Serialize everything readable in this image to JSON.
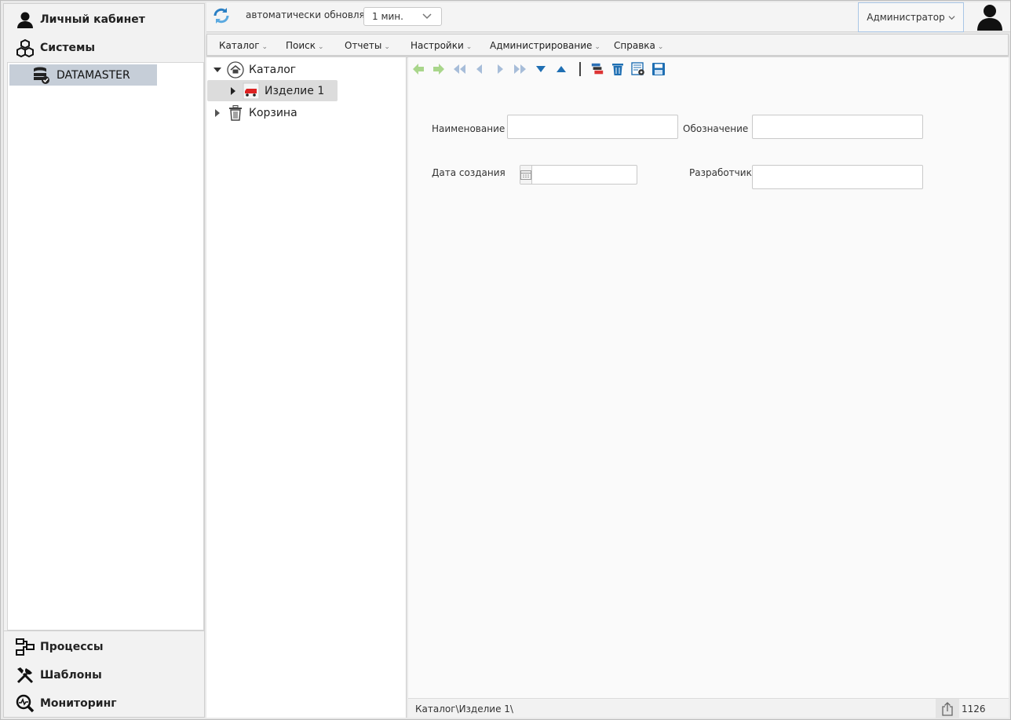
{
  "sidebar": {
    "top_items": [
      {
        "label": "Личный кабинет",
        "icon": "user-icon"
      },
      {
        "label": "Системы",
        "icon": "cubes-icon"
      }
    ],
    "tree_node": {
      "label": "DATAMASTER",
      "icon": "database-check-icon"
    },
    "bottom_items": [
      {
        "label": "Процессы",
        "icon": "process-icon"
      },
      {
        "label": "Шаблоны",
        "icon": "tools-icon"
      },
      {
        "label": "Мониторинг",
        "icon": "monitor-search-icon"
      }
    ]
  },
  "header": {
    "refresh_icon": "refresh-icon",
    "auto_refresh_label": "автоматически обновлять",
    "interval_value": "1 мин.",
    "user_menu_label": "Администратор",
    "avatar_icon": "avatar-icon"
  },
  "menu": [
    "Каталог",
    "Поиск",
    "Отчеты",
    "Настройки",
    "Администрирование",
    "Справка"
  ],
  "tree": {
    "root": {
      "label": "Каталог",
      "icon": "home-icon"
    },
    "child": {
      "label": "Изделие 1",
      "icon": "truck-icon"
    },
    "trash": {
      "label": "Корзина",
      "icon": "trash-icon"
    }
  },
  "form": {
    "name_label": "Наименование",
    "designation_label": "Обозначение",
    "created_label": "Дата создания",
    "developer_label": "Разработчик",
    "name_value": "",
    "designation_value": "",
    "created_value": "",
    "developer_value": ""
  },
  "status": {
    "path": "Каталог\\Изделие 1\\",
    "count": "1126"
  },
  "colors": {
    "accent_blue": "#1f6fb3",
    "nav_green": "#9fcf7f",
    "selected_bg": "#c6ced8"
  }
}
